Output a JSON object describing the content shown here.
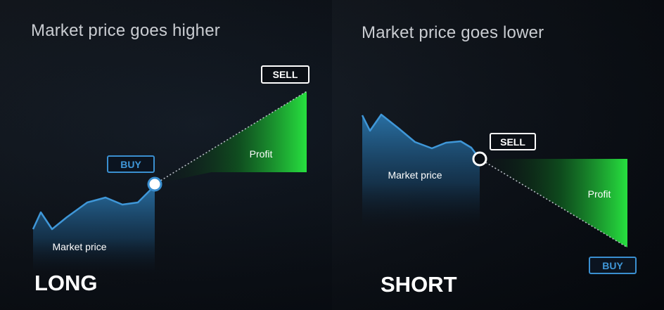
{
  "panels": {
    "long": {
      "title": "Market price goes higher",
      "market_label": "Market price",
      "entry_label": "BUY",
      "exit_label": "SELL",
      "profit_label": "Profit",
      "position_word": "LONG"
    },
    "short": {
      "title": "Market price goes lower",
      "market_label": "Market price",
      "entry_label": "SELL",
      "exit_label": "BUY",
      "profit_label": "Profit",
      "position_word": "SHORT"
    }
  },
  "colors": {
    "background": "#0a0e14",
    "price_line": "#3a8fd0",
    "price_fill": "#1f5a8a",
    "profit_green": "#22c93a",
    "buy_badge": "#3a8fd0",
    "sell_badge": "#ffffff"
  }
}
